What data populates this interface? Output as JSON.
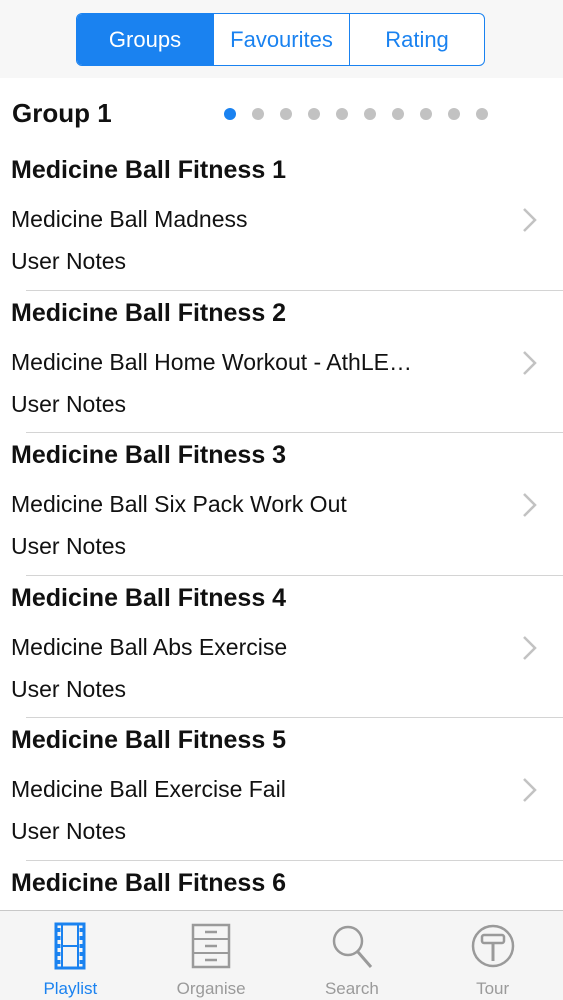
{
  "segmented": {
    "items": [
      "Groups",
      "Favourites",
      "Rating"
    ],
    "selected": "Groups"
  },
  "group": {
    "title": "Group 1",
    "page_count": 10,
    "current_page": 1
  },
  "rows": [
    {
      "title": "Medicine Ball Fitness 1",
      "subtitle": "Medicine Ball Madness",
      "notes": "User Notes"
    },
    {
      "title": "Medicine Ball Fitness 2",
      "subtitle": "Medicine Ball Home Workout - AthLE…",
      "notes": "User Notes"
    },
    {
      "title": "Medicine Ball Fitness 3",
      "subtitle": "Medicine Ball Six Pack Work Out",
      "notes": "User Notes"
    },
    {
      "title": "Medicine Ball Fitness 4",
      "subtitle": "Medicine Ball Abs Exercise",
      "notes": "User Notes"
    },
    {
      "title": "Medicine Ball Fitness 5",
      "subtitle": "Medicine Ball Exercise Fail",
      "notes": "User Notes"
    },
    {
      "title": "Medicine Ball Fitness 6",
      "subtitle": "",
      "notes": ""
    }
  ],
  "tabbar": {
    "items": [
      {
        "label": "Playlist",
        "icon": "film-strip-icon",
        "active": true
      },
      {
        "label": "Organise",
        "icon": "filing-cabinet-icon",
        "active": false
      },
      {
        "label": "Search",
        "icon": "magnifier-icon",
        "active": false
      },
      {
        "label": "Tour",
        "icon": "tour-sign-icon",
        "active": false
      }
    ]
  },
  "colors": {
    "accent": "#1a82f0",
    "inactive": "#9a9a9a",
    "dot_inactive": "#c2c2c2",
    "separator": "#d4d4d4"
  }
}
